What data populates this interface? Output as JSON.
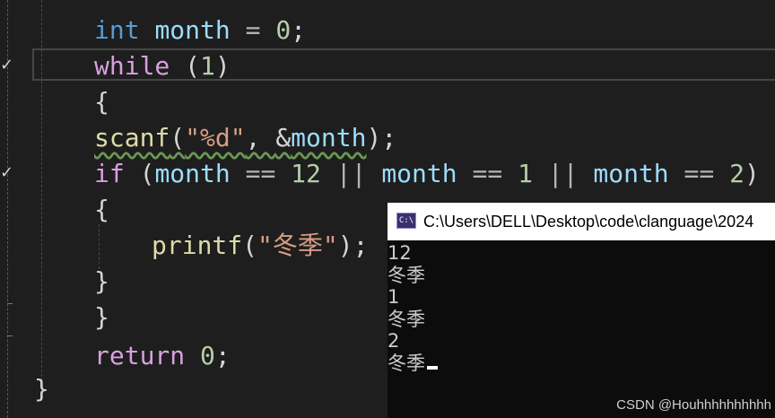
{
  "code": {
    "line1": {
      "kw": "int",
      "var": "month",
      "op": " = ",
      "num": "0",
      "end": ";"
    },
    "line2": {
      "kw": "while",
      "paren_open": " (",
      "num": "1",
      "paren_close": ")"
    },
    "line3": "{",
    "line4": {
      "fn": "scanf",
      "open": "(",
      "str": "\"%d\"",
      "sep": ", ",
      "amp": "&",
      "var": "month",
      "close": ");"
    },
    "line5": {
      "kw": "if",
      "open": " (",
      "v1": "month",
      "eq1": " == ",
      "n1": "12",
      "or1": " || ",
      "v2": "month",
      "eq2": " == ",
      "n2": "1",
      "or2": " || ",
      "v3": "month",
      "eq3": " == ",
      "n3": "2",
      "close": ")"
    },
    "line6": "{",
    "line7": {
      "fn": "printf",
      "open": "(",
      "str": "\"冬季\"",
      "close": ");"
    },
    "line8": "}",
    "line9": "}",
    "line10": {
      "kw": "return",
      "num": " 0",
      "end": ";"
    },
    "line11": "}"
  },
  "console": {
    "title": "C:\\Users\\DELL\\Desktop\\code\\clanguage\\2024",
    "icon_text": "C:\\",
    "lines": [
      "12",
      "冬季",
      "1",
      "冬季",
      "2",
      "冬季"
    ]
  },
  "watermark": "CSDN @Houhhhhhhhhhh",
  "icons": {
    "check": "checkmark-icon",
    "console": "console-app-icon"
  },
  "colors": {
    "background": "#1e1e1e",
    "keyword": "#569cd6",
    "control": "#d8a0df",
    "variable": "#9cdcfe",
    "number": "#b5cea8",
    "string": "#d69d85",
    "function": "#dcdcaa"
  }
}
